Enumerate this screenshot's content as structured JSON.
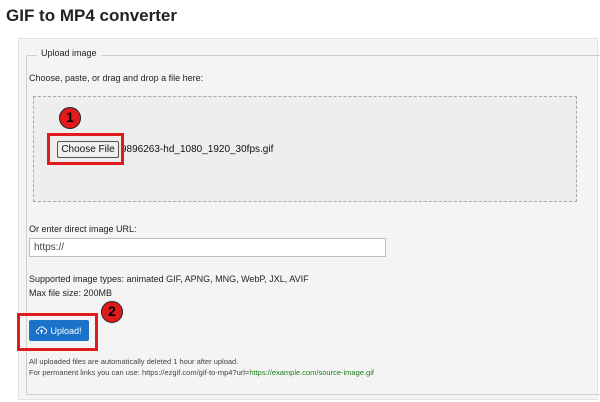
{
  "page_title": "GIF to MP4 converter",
  "upload_section": {
    "legend": "Upload image",
    "instruction": "Choose, paste, or drag and drop a file here:",
    "choose_file_label": "Choose File",
    "selected_file": "9896263-hd_1080_1920_30fps.gif",
    "url_label": "Or enter direct image URL:",
    "url_placeholder": "https://",
    "supported_types": "Supported image types: animated GIF, APNG, MNG, WebP, JXL, AVIF",
    "max_size": "Max file size: 200MB",
    "upload_label": "Upload!",
    "delete_note": "All uploaded files are automatically deleted 1 hour after upload.",
    "permalink_prefix": "For permanent links you can use: https://ezgif.com/gif-to-mp4?url=",
    "permalink_example": "https://example.com/source-image.gif"
  },
  "annotations": {
    "step1": "1",
    "step2": "2",
    "highlight_color": "#e01b1b"
  },
  "colors": {
    "upload_button": "#1a73c9",
    "link": "#1b7a1b"
  }
}
